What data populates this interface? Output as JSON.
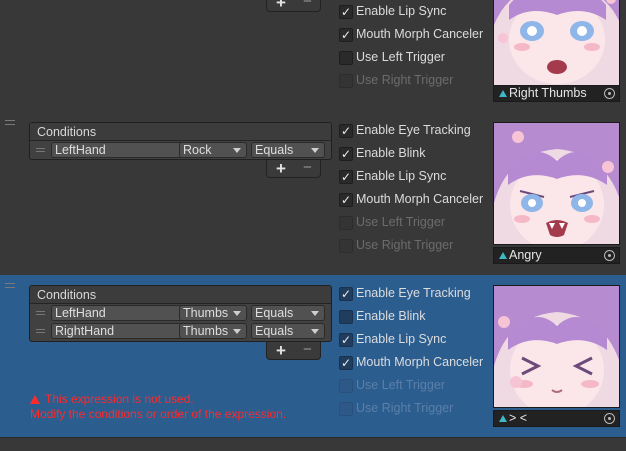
{
  "conditions_title": "Conditions",
  "rows": [
    {
      "toggles": [
        {
          "label": "Enable Lip Sync",
          "checked": true,
          "disabled": false
        },
        {
          "label": "Mouth Morph Canceler",
          "checked": true,
          "disabled": false
        },
        {
          "label": "Use Left Trigger",
          "checked": false,
          "disabled": false
        },
        {
          "label": "Use Right Trigger",
          "checked": false,
          "disabled": true
        }
      ],
      "thumbnail_label": "Right Thumbs"
    },
    {
      "conditions": [
        {
          "parameter": "LeftHand",
          "gesture": "Rock",
          "mode": "Equals"
        }
      ],
      "toggles": [
        {
          "label": "Enable Eye Tracking",
          "checked": true,
          "disabled": false
        },
        {
          "label": "Enable Blink",
          "checked": true,
          "disabled": false
        },
        {
          "label": "Enable Lip Sync",
          "checked": true,
          "disabled": false
        },
        {
          "label": "Mouth Morph Canceler",
          "checked": true,
          "disabled": false
        },
        {
          "label": "Use Left Trigger",
          "checked": false,
          "disabled": true
        },
        {
          "label": "Use Right Trigger",
          "checked": false,
          "disabled": true
        }
      ],
      "thumbnail_label": "Angry"
    },
    {
      "conditions": [
        {
          "parameter": "LeftHand",
          "gesture": "Thumbs",
          "mode": "Equals"
        },
        {
          "parameter": "RightHand",
          "gesture": "Thumbs",
          "mode": "Equals"
        }
      ],
      "toggles": [
        {
          "label": "Enable Eye Tracking",
          "checked": true,
          "disabled": false
        },
        {
          "label": "Enable Blink",
          "checked": false,
          "disabled": false
        },
        {
          "label": "Enable Lip Sync",
          "checked": true,
          "disabled": false
        },
        {
          "label": "Mouth Morph Canceler",
          "checked": true,
          "disabled": false
        },
        {
          "label": "Use Left Trigger",
          "checked": false,
          "disabled": true
        },
        {
          "label": "Use Right Trigger",
          "checked": false,
          "disabled": true
        }
      ],
      "thumbnail_label": "> <",
      "warning": {
        "line1": "This expression is not used.",
        "line2": "Modify the conditions or order of the expression."
      },
      "selected": true
    }
  ],
  "list_buttons": {
    "add": "+",
    "remove": "−"
  },
  "checkmark": "✓",
  "colors": {
    "background": "#383838",
    "selected_row": "#2c5d8f",
    "warning": "#ff2a2a",
    "thumbnail_icon": "#3db8c4"
  },
  "icons": {
    "drag": "drag-handle-icon",
    "dropdown": "chevron-down-icon",
    "checkbox": "checkmark-icon",
    "warning": "warning-triangle-icon",
    "thumbnail": "expression-asset-icon",
    "picker": "object-picker-icon"
  }
}
